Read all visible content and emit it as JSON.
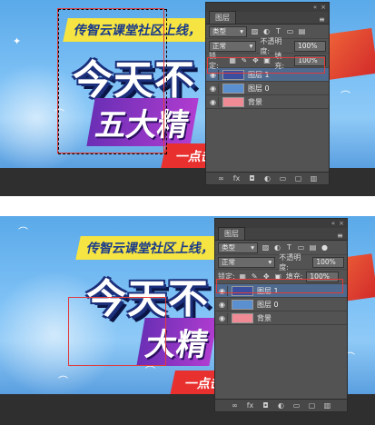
{
  "banner": {
    "slogan": "传智云课堂社区上线，",
    "headline_1": "今天不",
    "headline_2": "五大精",
    "headline_2b": "大精",
    "headline_char_2": "今天不",
    "ribbon": "点击",
    "ribbon_full": "一点击"
  },
  "panel": {
    "tab_label": "图层",
    "filter_label": "类型",
    "blend_mode": "正常",
    "opacity_label": "不透明度:",
    "opacity_value": "100%",
    "lock_label": "锁定:",
    "fill_label": "填充:",
    "fill_value": "100%",
    "layers": [
      {
        "name": "图层 1",
        "thumb_color": "#3a4fa0",
        "active": true
      },
      {
        "name": "图层 0",
        "thumb_color": "#5a8fd0",
        "active": false
      },
      {
        "name": "背景",
        "thumb_color": "#f08a95",
        "active": false
      }
    ],
    "icons": {
      "collapse": "«",
      "close": "×",
      "menu": "≡",
      "eye": "◉",
      "dropdown": "▾",
      "link": "∞",
      "fx": "fx",
      "mask": "◘",
      "adjust": "◐",
      "folder": "▭",
      "new": "▢",
      "trash": "▥",
      "lock_pixels": "▦",
      "lock_paint": "✎",
      "lock_move": "✥",
      "lock_artboard": "▣",
      "lock_all": "🔒",
      "filter_image": "▨",
      "filter_adjust": "◐",
      "filter_text": "T",
      "filter_shape": "▭",
      "filter_smart": "▤",
      "filter_toggle": "●"
    }
  },
  "colors": {
    "selection_box": "#e23a3a",
    "panel_bg": "#535353",
    "active_layer": "#4f6a8f"
  }
}
